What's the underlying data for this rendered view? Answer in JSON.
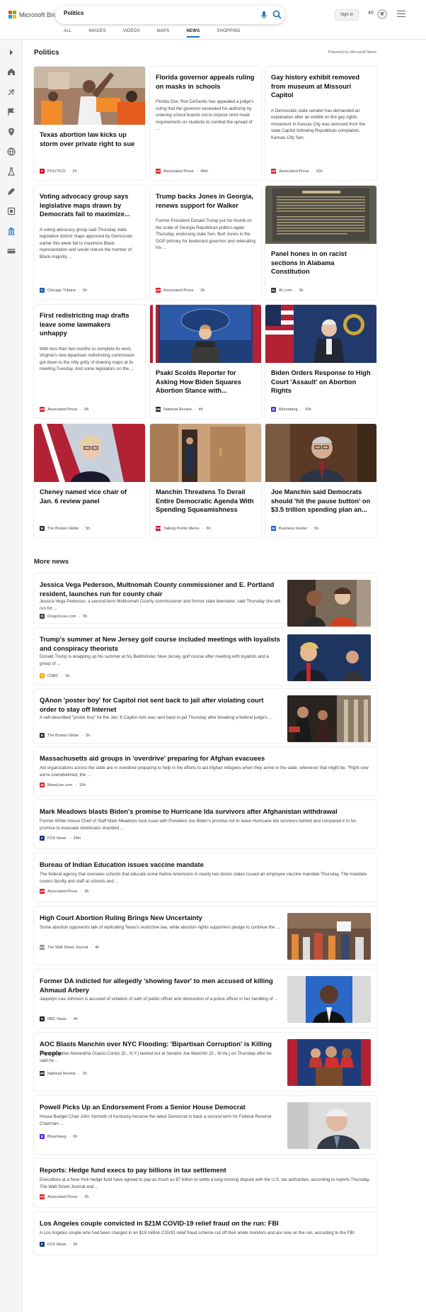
{
  "header": {
    "brand": "Microsoft Bing",
    "search_value": "Politics",
    "signin_label": "Sign in",
    "rewards_count": "40",
    "nav": [
      "ALL",
      "IMAGES",
      "VIDEOS",
      "MAPS",
      "NEWS",
      "SHOPPING"
    ],
    "nav_active": "NEWS"
  },
  "sidebar_icons": [
    "chevron-right-icon",
    "home-icon",
    "sports-icon",
    "flag-icon",
    "location-pin-icon",
    "globe-icon",
    "science-icon",
    "technology-icon",
    "entertainment-icon",
    "politics-icon",
    "money-icon"
  ],
  "section": {
    "title": "Politics",
    "powered": "Powered by Microsoft News"
  },
  "cards": [
    {
      "title": "Texas abortion law kicks up storm over private right to sue",
      "desc": "",
      "source": "POLITICO",
      "time": "2h",
      "badge": "P",
      "badge_color": "#d4002a",
      "image": "protest"
    },
    {
      "title": "Florida governor appeals ruling on masks in schools",
      "desc": "Florida Gov. Ron DeSantis has appealed a judge's ruling that the governor exceeded his authority by ordering school boards not to impose strict mask requirements on students to combat the spread of ...",
      "source": "Associated Press",
      "time": "49m",
      "badge": "AP",
      "badge_color": "#e31b23",
      "image": ""
    },
    {
      "title": "Gay history exhibit removed from museum at Missouri Capitol",
      "desc": "A Democratic state senator has demanded an explanation after an exhibit on the gay rights movement in Kansas City was removed from the state Capitol following Republican complaints. Kansas City Sen.",
      "source": "Associated Press",
      "time": "10h",
      "badge": "AP",
      "badge_color": "#e31b23",
      "image": ""
    },
    {
      "title": "Voting advocacy group says legislative maps drawn by Democrats fail to maximize...",
      "desc": "A voting advocacy group said Thursday state legislative district maps approved by Democrats earlier this week fail to maximize Black representation and would reduce the number of Black-majority ...",
      "source": "Chicago Tribune",
      "time": "5h",
      "badge": "C",
      "badge_color": "#1f5ea8",
      "image": ""
    },
    {
      "title": "Trump backs Jones in Georgia, renews support for Walker",
      "desc": "Former President Donald Trump put his thumb on the scale of Georgia Republican politics again Thursday, endorsing state Sen. Burt Jones in the GOP primary for lieutenant governor and reiterating his ...",
      "source": "Associated Press",
      "time": "2h",
      "badge": "AP",
      "badge_color": "#e31b23",
      "image": ""
    },
    {
      "title": "Panel hones in on racist sections in Alabama Constitution",
      "desc": "",
      "source": "AL.com",
      "time": "3h",
      "badge": "AL",
      "badge_color": "#333333",
      "image": "plaque"
    },
    {
      "title": "First redistricting map drafts leave some lawmakers unhappy",
      "desc": "With less than two months to complete its work, Virginia's new bipartisan redistricting commission got down to the nitty gritty of drawing maps at its meeting Tuesday. And some legislators on the ...",
      "source": "Associated Press",
      "time": "6h",
      "badge": "AP",
      "badge_color": "#e31b23",
      "image": ""
    },
    {
      "title": "Psaki Scolds Reporter for Asking How Biden Squares Abortion Stance with...",
      "desc": "",
      "source": "National Review",
      "time": "4h",
      "badge": "NR",
      "badge_color": "#222222",
      "image": "podium"
    },
    {
      "title": "Biden Orders Response to High Court 'Assault' on Abortion Rights",
      "desc": "",
      "source": "Bloomberg",
      "time": "10h",
      "badge": "B",
      "badge_color": "#5a2bd6",
      "image": "biden"
    },
    {
      "title": "Cheney named vice chair of Jan. 6 review panel",
      "desc": "",
      "source": "The Boston Globe",
      "time": "5h",
      "badge": "B",
      "badge_color": "#333333",
      "image": "cheney"
    },
    {
      "title": "Manchin Threatens To Derail Entire Democratic Agenda With Spending Squeamishness",
      "desc": "",
      "source": "Talking Points Memo",
      "time": "6h",
      "badge": "TPM",
      "badge_color": "#c8102e",
      "image": "door"
    },
    {
      "title": "Joe Manchin said Democrats should 'hit the pause button' on $3.5 trillion spending plan an...",
      "desc": "",
      "source": "Business Insider",
      "time": "5h",
      "badge": "BI",
      "badge_color": "#1e5bd8",
      "image": "manchin"
    }
  ],
  "more_news": {
    "title": "More news",
    "items": [
      {
        "title": "Jessica Vega Pederson, Multnomah County commissioner and E. Portland resident, launches run for county chair",
        "desc": "Jessica Vega Pederson, a second-term Multnomah County commissioner and former state lawmaker, said Thursday she will run for ...",
        "source": "OregonLive.com",
        "time": "5h",
        "badge": "O",
        "badge_color": "#444444",
        "image": "people"
      },
      {
        "title": "Trump's summer at New Jersey golf course included meetings with loyalists and conspiracy theorists",
        "desc": "Donald Trump is wrapping up his summer at his Bedminster, New Jersey, golf course after meeting with loyalists and a group of ...",
        "source": "CNBC",
        "time": "5h",
        "badge": "N",
        "badge_color": "#f2a900",
        "image": "trump"
      },
      {
        "title": "QAnon 'poster boy' for Capitol riot sent back to jail after violating court order to stay off Internet",
        "desc": "A self-described \"poster boy\" for the Jan. 6 Capitol riots was sent back to jail Thursday after breaking a federal judge's ...",
        "source": "The Boston Globe",
        "time": "5h",
        "badge": "B",
        "badge_color": "#333333",
        "image": "riot"
      },
      {
        "title": "Massachusetts aid groups in 'overdrive' preparing for Afghan evacuees",
        "desc": "Aid organizations across the state are in overdrive preparing to help in the efforts to aid Afghan refugees when they arrive in the state, whenever that might be. \"Right now we're overwhelmed, the ...",
        "source": "MassLive.com",
        "time": "10h",
        "badge": "M",
        "badge_color": "#d0312d",
        "image": ""
      },
      {
        "title": "Mark Meadows blasts Biden's promise to Hurricane Ida survivors after Afghanistan withdrawal",
        "desc": "Former White House Chief of Staff Mark Meadows took issue with President Joe Biden's promise not to leave Hurricane Ida survivors behind and compared it to his promise to evacuate Americans stranded ...",
        "source": "FOX News",
        "time": "28m",
        "badge": "F",
        "badge_color": "#1a3a7a",
        "image": ""
      },
      {
        "title": "Bureau of Indian Education issues vaccine mandate",
        "desc": "The federal agency that oversees schools that educate some Native Americans in nearly two dozen states issued an employee vaccine mandate Thursday. The mandate covers faculty and staff at schools and ...",
        "source": "Associated Press",
        "time": "3h",
        "badge": "AP",
        "badge_color": "#e31b23",
        "image": ""
      },
      {
        "title": "High Court Abortion Ruling Brings New Uncertainty",
        "desc": "Some abortion opponents talk of replicating Texas's restrictive law, while abortion-rights supporters pledge to continue the ...",
        "source": "The Wall Street Journal",
        "time": "4h",
        "badge": "WSJ",
        "badge_color": "#888888",
        "image": "crowd"
      },
      {
        "title": "Former DA indicted for allegedly 'showing favor' to men accused of killing Ahmaud Arbery",
        "desc": "Jaquelyn Lee Johnson is accused of violation of oath of public officer and obstruction of a police officer in her handling of ...",
        "source": "NBC News",
        "time": "4h",
        "badge": "N",
        "badge_color": "#222222",
        "image": "arbery"
      },
      {
        "title": "AOC Blasts Manchin over NYC Flooding: 'Bipartisan Corruption' is Killing People",
        "desc": "Representative Alexandria Ocasio-Cortez (D., N.Y.) lashed out at Senator Joe Manchin (D., W.Va.) on Thursday after he said he ...",
        "source": "National Review",
        "time": "2h",
        "badge": "NR",
        "badge_color": "#222222",
        "image": "aoc"
      },
      {
        "title": "Powell Picks Up an Endorsement From a Senior House Democrat",
        "desc": "House Budget Chair John Yarmuth of Kentucky became the latest Democrat to back a second term for Federal Reserve Chairman ...",
        "source": "Bloomberg",
        "time": "6h",
        "badge": "B",
        "badge_color": "#5a2bd6",
        "image": "powell"
      },
      {
        "title": "Reports: Hedge fund execs to pay billions in tax settlement",
        "desc": "Executives at a New York hedge fund have agreed to pay as much as $7 billion to settle a long-running dispute with the U.S. tax authorities, according to reports Thursday. The Wall Street Journal and ...",
        "source": "Associated Press",
        "time": "2h",
        "badge": "AP",
        "badge_color": "#e31b23",
        "image": ""
      },
      {
        "title": "Los Angeles couple convicted in $21M COVID-19 relief fraud on the run: FBI",
        "desc": "A Los Angeles couple who had been charged in an $18 million COVID relief fraud scheme cut off their ankle monitors and are now on the run, according to the FBI.",
        "source": "FOX News",
        "time": "5h",
        "badge": "F",
        "badge_color": "#1a3a7a",
        "image": ""
      }
    ]
  }
}
